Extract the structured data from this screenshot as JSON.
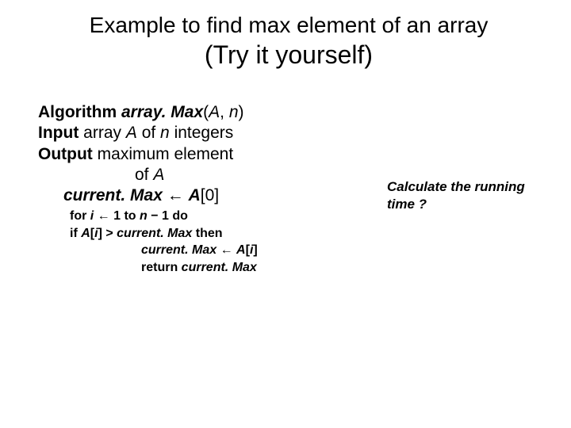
{
  "title": {
    "line1": "Example to find max element of an array",
    "line2": "(Try it yourself)"
  },
  "algo": {
    "line1": {
      "kw": "Algorithm ",
      "name": "array. Max",
      "args_open": "(",
      "argA": "A",
      "sep": ", ",
      "argN": "n",
      "args_close": ")"
    },
    "line2": {
      "kw": "Input ",
      "t1": "array ",
      "A": "A",
      "t2": " of ",
      "n": "n",
      "t3": " integers"
    },
    "line3": {
      "kw": "Output ",
      "t1": "maximum element"
    },
    "line4": {
      "t1": "of ",
      "A": "A"
    },
    "line5": {
      "cm": "current. Max ",
      "arrow": "← ",
      "A": "A",
      "idx": "[0]"
    },
    "line6": {
      "for": "for ",
      "i": "i ",
      "arrow": "← ",
      "one": "1 ",
      "to": "to ",
      "n": "n ",
      "minus": "− ",
      "one2": "1 ",
      "do": "do"
    },
    "line7": {
      "if": "if ",
      "A": "A",
      "lb": "[",
      "i": "i",
      "rb": "] ",
      "gt": "> ",
      "cm": "current. Max ",
      "then": "then"
    },
    "line8": {
      "cm": "current. Max ",
      "arrow": "← ",
      "A": "A",
      "lb": "[",
      "i": "i",
      "rb": "]"
    },
    "line9": {
      "ret": "return ",
      "cm": "current. Max"
    }
  },
  "note": {
    "line1": "Calculate the running",
    "line2": "time ?"
  }
}
